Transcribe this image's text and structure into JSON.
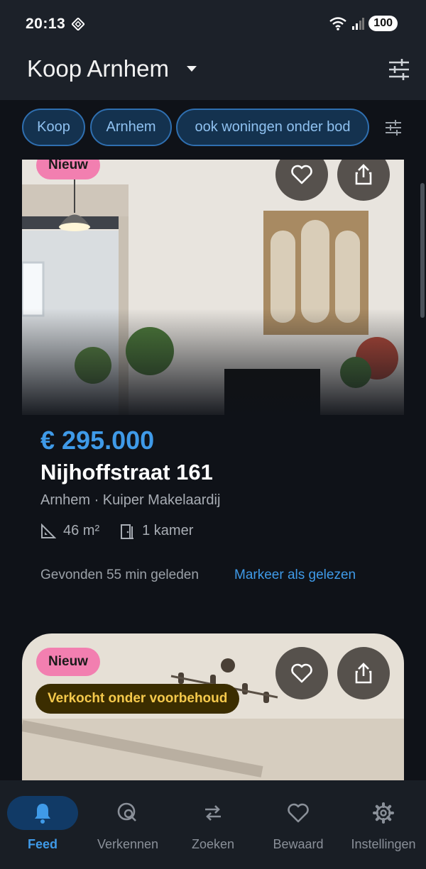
{
  "status_bar": {
    "time": "20:13",
    "battery": "100"
  },
  "app_bar": {
    "title": "Koop Arnhem"
  },
  "chips": [
    {
      "label": "Koop"
    },
    {
      "label": "Arnhem"
    },
    {
      "label": "ook woningen onder bod"
    }
  ],
  "listings": [
    {
      "badge": "Nieuw",
      "price": "€ 295.000",
      "street": "Nijhoffstraat 161",
      "location_agent": "Arnhem · Kuiper Makelaardij",
      "area": "46 m²",
      "rooms": "1 kamer",
      "found": "Gevonden 55 min geleden",
      "mark_read": "Markeer als gelezen"
    },
    {
      "badge": "Nieuw",
      "status": "Verkocht onder voorbehoud"
    }
  ],
  "bottom_nav": [
    {
      "label": "Feed",
      "icon": "bell-icon",
      "active": true
    },
    {
      "label": "Verkennen",
      "icon": "explore-icon",
      "active": false
    },
    {
      "label": "Zoeken",
      "icon": "search-swap-icon",
      "active": false
    },
    {
      "label": "Bewaard",
      "icon": "heart-icon",
      "active": false
    },
    {
      "label": "Instellingen",
      "icon": "gear-icon",
      "active": false
    }
  ],
  "colors": {
    "accent": "#3f9ae8",
    "badge_new": "#f27fb0",
    "badge_sold_bg": "#3b2d00",
    "badge_sold_text": "#f5c94c",
    "background": "#0f1218",
    "bar": "#1c2129"
  }
}
